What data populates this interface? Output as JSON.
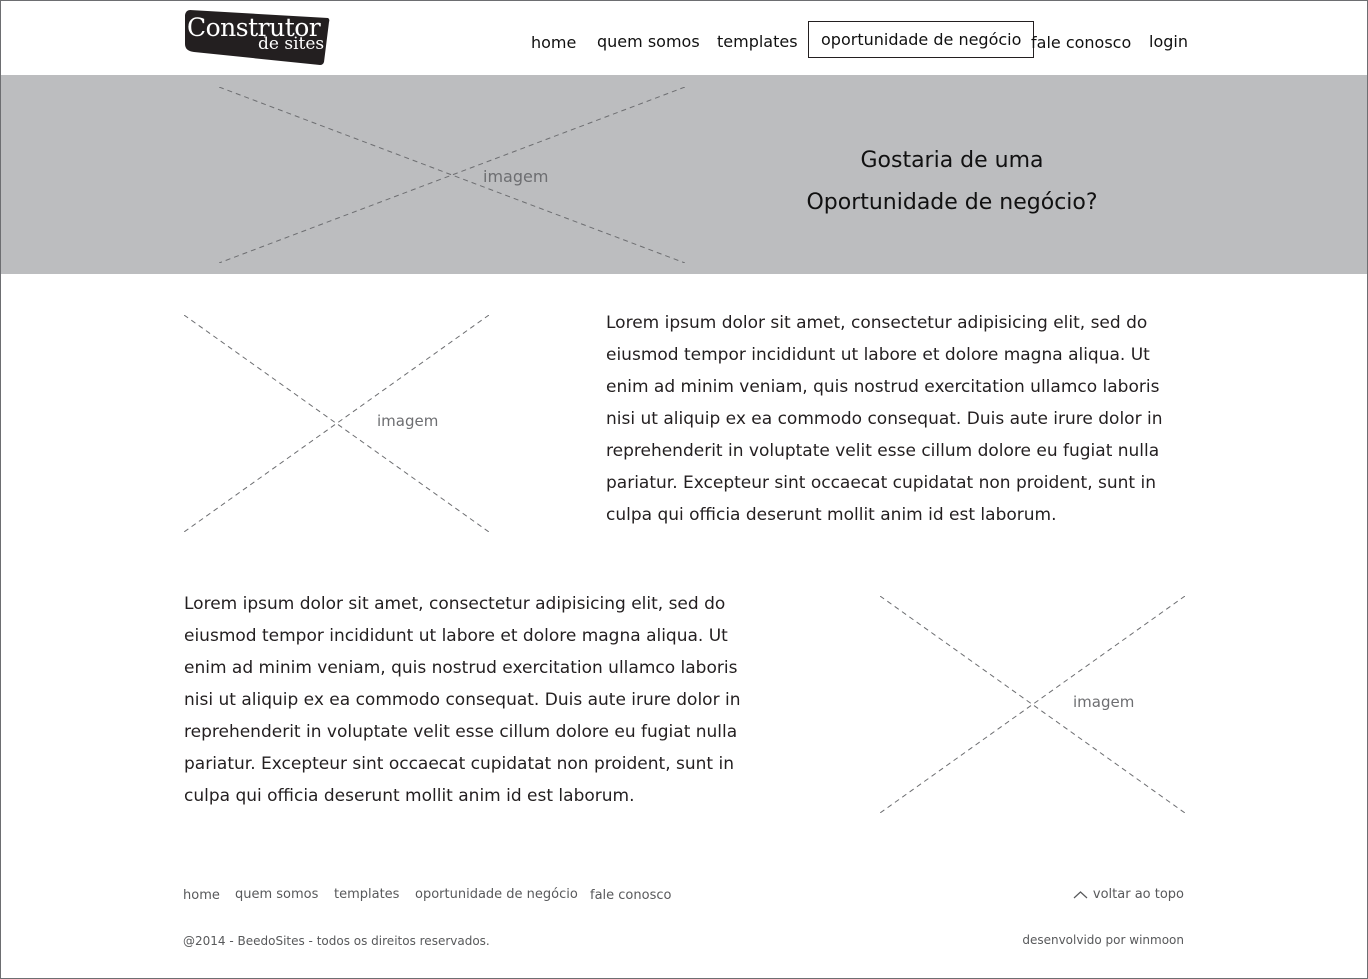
{
  "logo": {
    "line1": "Construtor",
    "line2": "de sites"
  },
  "nav": {
    "items": [
      "home",
      "quem somos",
      "templates",
      "oportunidade de negócio",
      "fale conosco",
      "login"
    ],
    "active": "oportunidade de negócio"
  },
  "hero": {
    "image_label": "imagem",
    "title_line1": "Gostaria de uma",
    "title_line2": "Oportunidade de negócio?"
  },
  "section1": {
    "image_label": "imagem",
    "text": "Lorem ipsum dolor sit amet, consectetur adipisicing elit, sed do eiusmod tempor incididunt ut labore et dolore magna aliqua. Ut enim ad minim veniam, quis nostrud exercitation ullamco laboris nisi ut aliquip ex ea commodo consequat. Duis aute irure dolor in reprehenderit in voluptate velit esse cillum dolore eu fugiat nulla pariatur. Excepteur sint occaecat cupidatat non proident, sunt in culpa qui officia deserunt mollit anim id est laborum."
  },
  "section2": {
    "image_label": "imagem",
    "text": "Lorem ipsum dolor sit amet, consectetur adipisicing elit, sed do eiusmod tempor incididunt ut labore et dolore magna aliqua. Ut enim ad minim veniam, quis nostrud exercitation ullamco laboris nisi ut aliquip ex ea commodo consequat. Duis aute irure dolor in reprehenderit in voluptate velit esse cillum dolore eu fugiat nulla pariatur. Excepteur sint occaecat cupidatat non proident, sunt in culpa qui officia deserunt mollit anim id est laborum."
  },
  "footer": {
    "links": [
      "home",
      "quem somos",
      "templates",
      "oportunidade de negócio",
      "fale conosco"
    ],
    "back_to_top": "voltar ao topo",
    "copyright": "@2014 - BeedoSites - todos os direitos reservados.",
    "developer": "desenvolvido por winmoon"
  },
  "colors": {
    "hero_bg": "#bcbdbf",
    "logo_bg": "#231f20",
    "text": "#231f20",
    "muted": "#58595b"
  }
}
